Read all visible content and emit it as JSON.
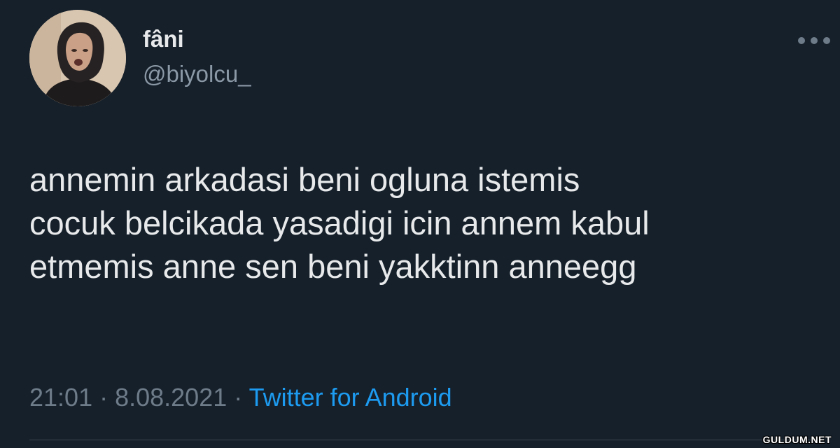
{
  "tweet": {
    "author": {
      "display_name": "fâni",
      "handle": "@biyolcu_"
    },
    "menu_icon": "more-horizontal-icon",
    "text_lines": [
      "annemin arkadasi beni ogluna istemis",
      "cocuk belcikada yasadigi icin annem kabul",
      "etmemis anne sen beni yakktinn anneegg"
    ],
    "timestamp": "21:01 · 8.08.2021 · ",
    "source": "Twitter for Android"
  },
  "watermark": "GULDUM.NET",
  "colors": {
    "background": "#15202b",
    "primary_text": "#e7e9ea",
    "secondary_text": "#8b98a5",
    "link": "#1d9bf0"
  }
}
